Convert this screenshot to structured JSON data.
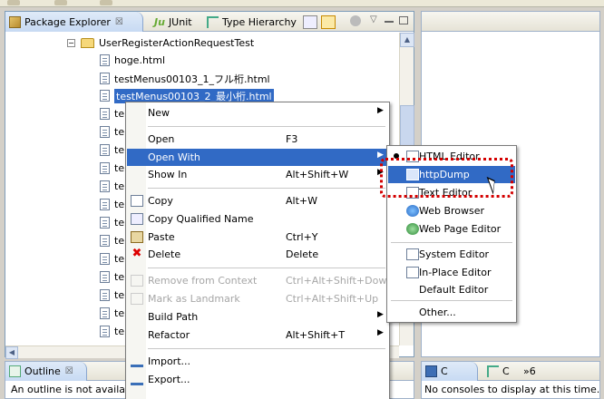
{
  "package_explorer": {
    "tabs": [
      {
        "label": "Package Explorer",
        "close": "☒"
      },
      {
        "label": "JUnit",
        "icon_text": "Ju"
      },
      {
        "label": "Type Hierarchy"
      }
    ],
    "tree": {
      "folder": {
        "label": "UserRegisterActionRequestTest",
        "expander": "−"
      },
      "files": [
        "hoge.html",
        "testMenus00103_1_フル桁.html",
        "testMenus00103_2_最小桁.html",
        "te",
        "te",
        "te",
        "te",
        "te",
        "te",
        "te",
        "te",
        "te",
        "te",
        "te",
        "te",
        "te"
      ],
      "selected_index": 2
    }
  },
  "outline": {
    "tab_label": "Outline",
    "close": "☒",
    "message": "An outline is not available."
  },
  "console": {
    "tab_c1": "C",
    "tab_c2": "C",
    "overflow": "»6",
    "message": "No consoles to display at this time."
  },
  "context_menu": {
    "items": [
      {
        "label": "New",
        "accel": "",
        "submenu": true
      },
      {
        "sep": true
      },
      {
        "label": "Open",
        "accel": "F3"
      },
      {
        "label": "Open With",
        "accel": "",
        "submenu": true,
        "highlighted": true
      },
      {
        "label": "Show In",
        "accel": "Alt+Shift+W",
        "submenu": true
      },
      {
        "sep": true
      },
      {
        "label": "Copy",
        "accel": "Alt+W",
        "icon": "copy-icon"
      },
      {
        "label": "Copy Qualified Name",
        "accel": "",
        "icon": "copy-qualified-icon"
      },
      {
        "label": "Paste",
        "accel": "Ctrl+Y",
        "icon": "paste-icon"
      },
      {
        "label": "Delete",
        "accel": "Delete",
        "icon": "delete-icon"
      },
      {
        "sep": true
      },
      {
        "label": "Remove from Context",
        "accel": "Ctrl+Alt+Shift+Down",
        "disabled": true,
        "icon": "remove-context-icon"
      },
      {
        "label": "Mark as Landmark",
        "accel": "Ctrl+Alt+Shift+Up",
        "disabled": true,
        "icon": "landmark-icon"
      },
      {
        "label": "Build Path",
        "accel": "",
        "submenu": true
      },
      {
        "label": "Refactor",
        "accel": "Alt+Shift+T",
        "submenu": true
      },
      {
        "sep": true
      },
      {
        "label": "Import...",
        "accel": "",
        "icon": "import-icon"
      },
      {
        "label": "Export...",
        "accel": "",
        "icon": "export-icon"
      }
    ]
  },
  "open_with_menu": {
    "items": [
      {
        "label": "HTML Editor",
        "checked": true,
        "icon": "html-editor-icon"
      },
      {
        "label": "httpDump",
        "highlighted": true,
        "icon": "httpdump-icon"
      },
      {
        "label": "Text Editor",
        "icon": "text-editor-icon"
      },
      {
        "label": "Web Browser",
        "icon": "web-browser-icon"
      },
      {
        "label": "Web Page Editor",
        "icon": "web-page-editor-icon"
      },
      {
        "sep": true
      },
      {
        "label": "System Editor",
        "icon": "system-editor-icon"
      },
      {
        "label": "In-Place Editor",
        "icon": "in-place-editor-icon"
      },
      {
        "label": "Default Editor"
      },
      {
        "sep": true
      },
      {
        "label": "Other..."
      }
    ]
  },
  "colors": {
    "selection": "#316ac5",
    "callout": "#d40000",
    "menu_bg": "#ffffff",
    "frame_bg": "#d4d0c8"
  }
}
